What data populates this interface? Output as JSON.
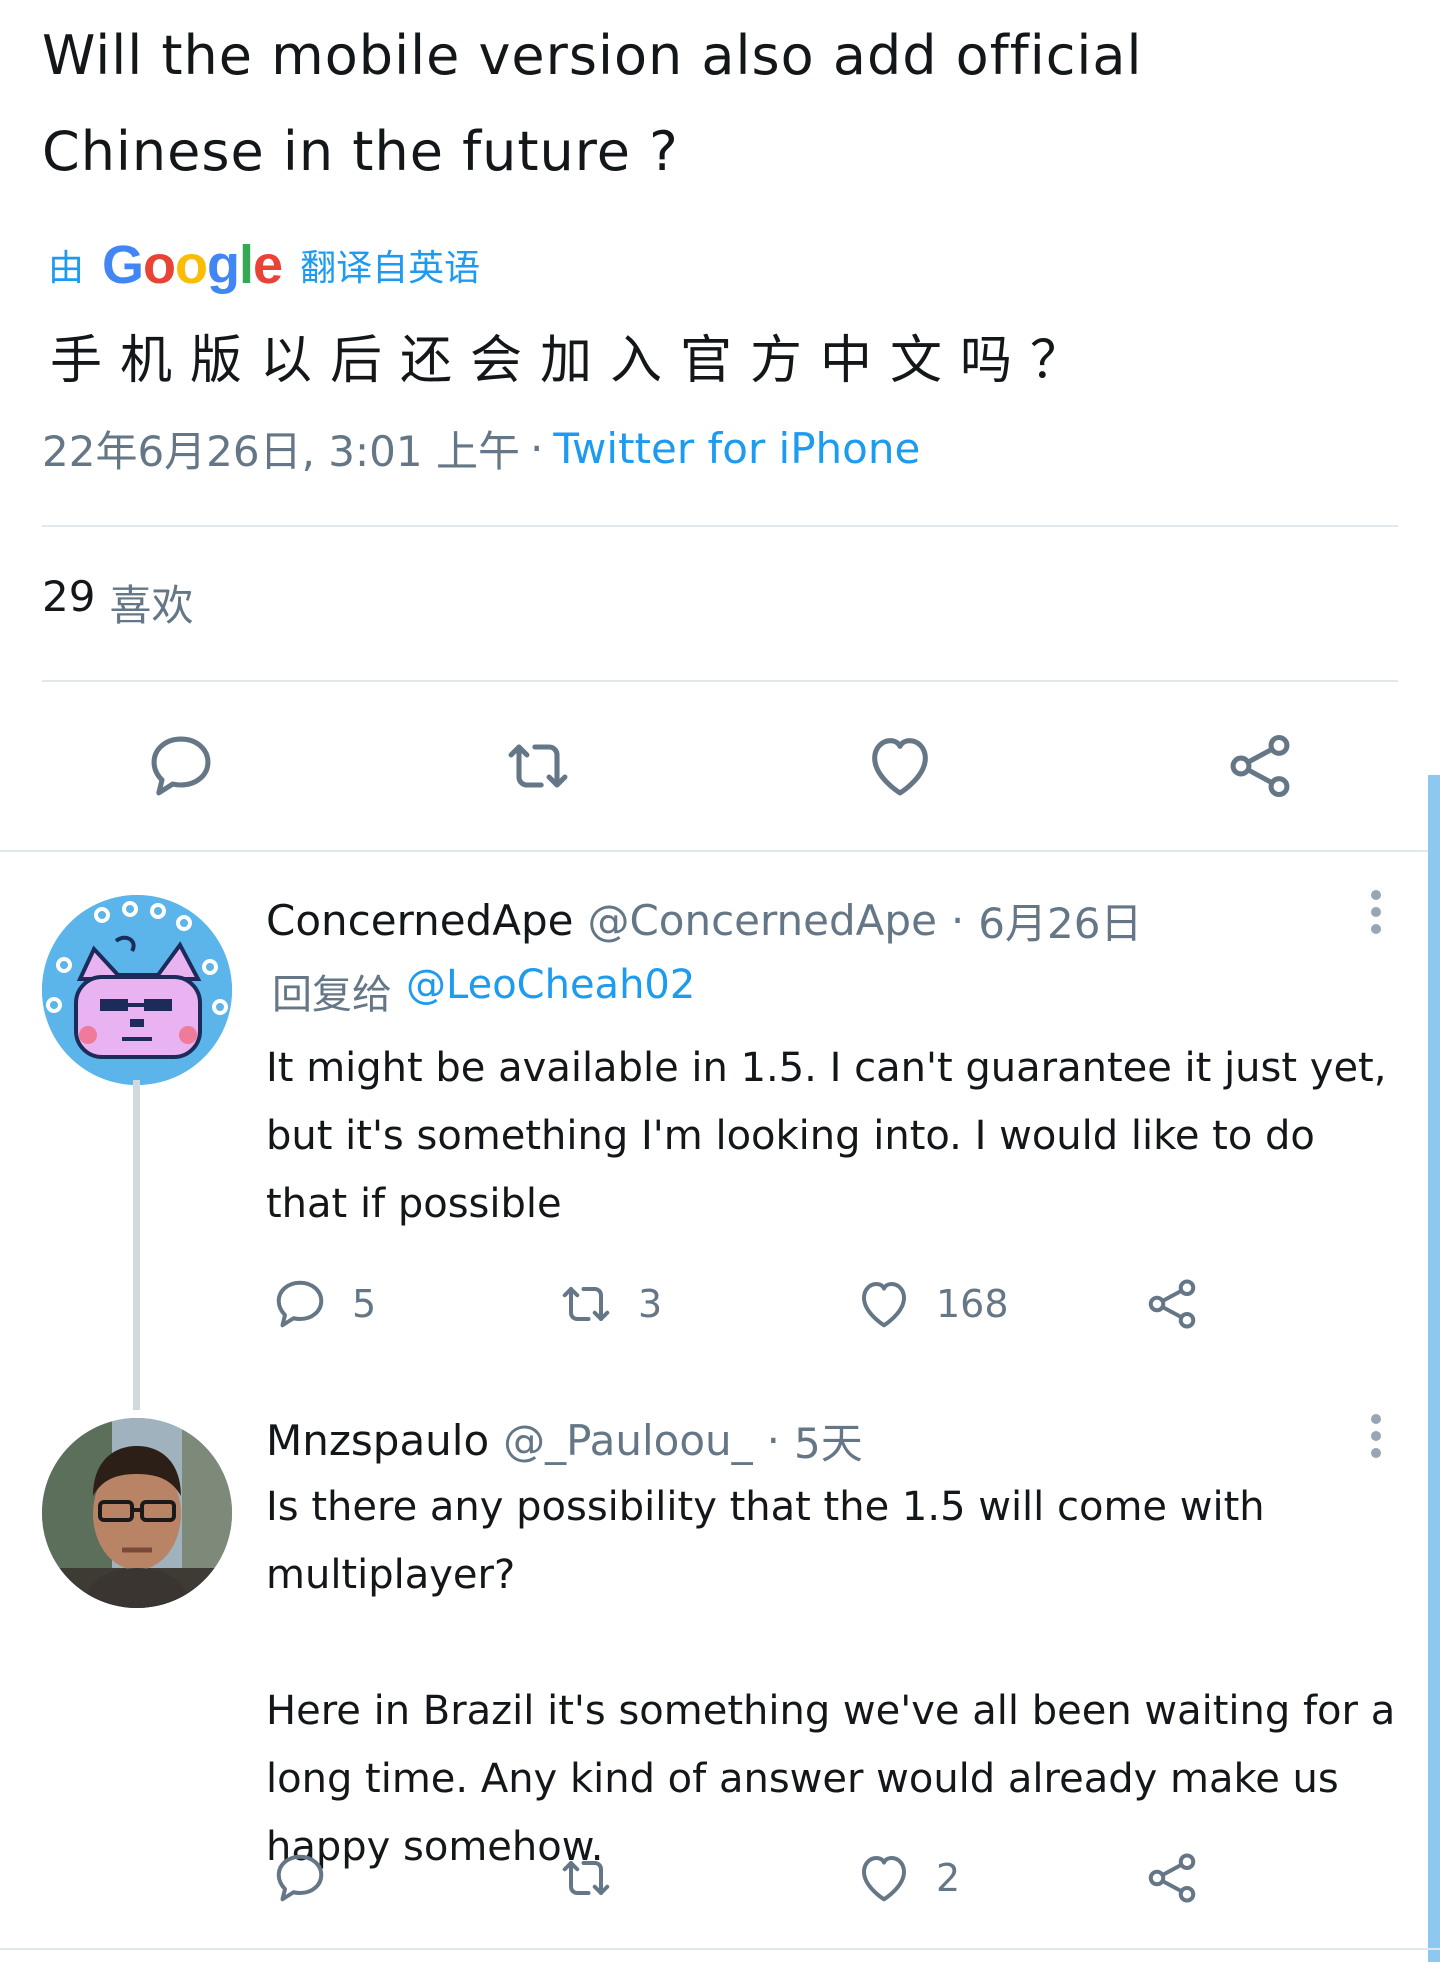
{
  "tweet": {
    "text": "Will the mobile version also add official Chinese in the future ?",
    "translated_prefix": "由",
    "translator_name": "Google",
    "translated_suffix": "翻译自英语",
    "translated_text": "手机版以后还会加入官方中文吗？",
    "timestamp": "22年6月26日, 3:01 上午",
    "separator": "·",
    "source": "Twitter for iPhone",
    "like_count": "29",
    "like_label": "喜欢"
  },
  "replies": [
    {
      "name": "ConcernedApe",
      "handle": "@ConcernedApe",
      "separator": "·",
      "time": "6月26日",
      "replying_to_label": "回复给",
      "replying_to_handle": "@LeoCheah02",
      "body": [
        "It might be available in 1.5. I can't guarantee it just yet, but it's something I'm looking into. I would like to do that if possible"
      ],
      "reply_count": "5",
      "retweet_count": "3",
      "like_count": "168"
    },
    {
      "name": "Mnzspaulo",
      "handle": "@_Pauloou_",
      "separator": "·",
      "time": "5天",
      "body": [
        "Is there any possibility that the 1.5 will come with multiplayer?",
        "Here in Brazil it's something we've all been waiting for a long time. Any kind of answer would already make us happy somehow."
      ],
      "like_count": "2"
    }
  ],
  "icons": {
    "reply": "speech-bubble-icon",
    "retweet": "retweet-arrows-icon",
    "like": "heart-icon",
    "share": "share-nodes-icon",
    "more": "vertical-ellipsis-icon"
  },
  "colors": {
    "link": "#1d9bf0",
    "muted": "#657786",
    "text": "#14171a",
    "divider": "#e1e8ed",
    "scrollbar": "#8cc8f0"
  }
}
